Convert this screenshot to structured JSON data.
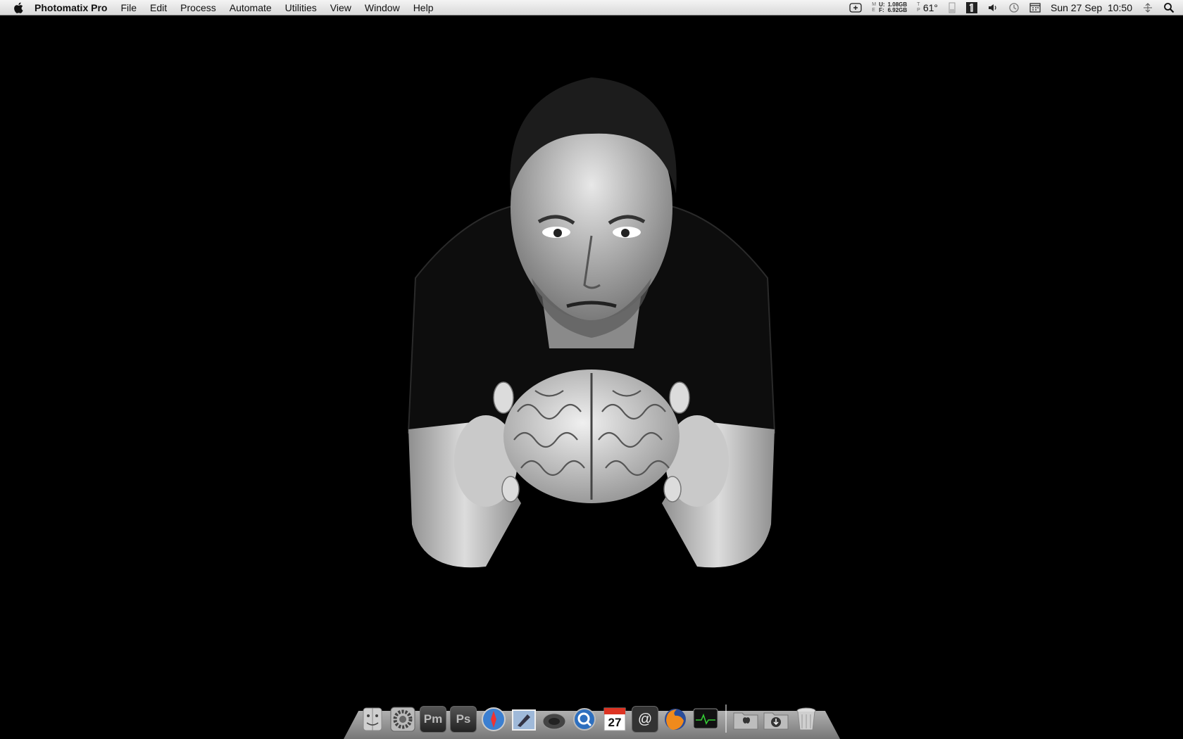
{
  "menubar": {
    "app_name": "Photomatix Pro",
    "menus": [
      "File",
      "Edit",
      "Process",
      "Automate",
      "Utilities",
      "View",
      "Window",
      "Help"
    ],
    "status": {
      "mem_labels_left": [
        "M",
        "E",
        "M"
      ],
      "mem_used_label": "U:",
      "mem_free_label": "F:",
      "mem_used": "1.08GB",
      "mem_free": "6.92GB",
      "temp_labels": [
        "T",
        "M",
        "P"
      ],
      "temperature": "61°",
      "clock": "Sun 27 Sep  10:50"
    }
  },
  "dock": {
    "items": [
      {
        "name": "finder-icon"
      },
      {
        "name": "system-preferences-icon"
      },
      {
        "name": "photomatix-icon",
        "label": "Pm"
      },
      {
        "name": "photoshop-icon",
        "label": "Ps"
      },
      {
        "name": "safari-icon"
      },
      {
        "name": "mail-icon"
      },
      {
        "name": "speaker-icon"
      },
      {
        "name": "quicktime-icon"
      },
      {
        "name": "calendar-icon",
        "label": "27"
      },
      {
        "name": "address-book-icon",
        "label": "@"
      },
      {
        "name": "firefox-icon"
      },
      {
        "name": "activity-monitor-icon"
      }
    ],
    "right_items": [
      {
        "name": "applications-folder-icon"
      },
      {
        "name": "downloads-folder-icon"
      },
      {
        "name": "trash-icon"
      }
    ]
  }
}
